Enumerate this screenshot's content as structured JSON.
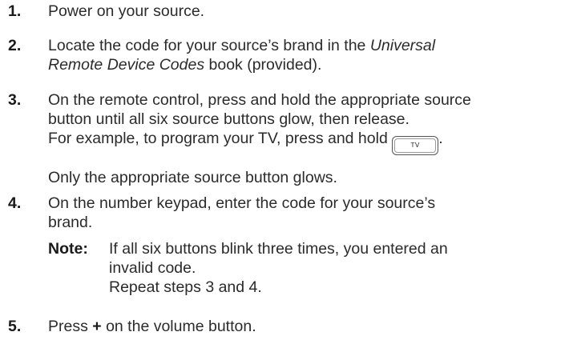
{
  "steps": [
    {
      "number": "1.",
      "text": "Power on your source."
    },
    {
      "number": "2.",
      "text_before": "Locate the code for your source’s brand in the ",
      "book_part1": "Universal",
      "book_part2": "Remote Device Codes",
      "text_after": " book (provided)."
    },
    {
      "number": "3.",
      "line1": "On the remote control, press and hold the appropriate source",
      "line2": "button until all six source buttons glow, then release.",
      "line3": "For example, to program your TV, press and hold",
      "button_label": "TV",
      "line3_end": ".",
      "followup": "Only the appropriate source button glows."
    },
    {
      "number": "4.",
      "line1": "On the number keypad, enter the code for your source’s",
      "line2": "brand.",
      "note_label": "Note:",
      "note_line1": "If all six buttons blink three times, you entered an",
      "note_line2": "invalid code.",
      "note_line3": "Repeat steps 3 and 4."
    },
    {
      "number": "5.",
      "text_before": "Press ",
      "plus": "+",
      "text_after": " on the volume button."
    }
  ]
}
